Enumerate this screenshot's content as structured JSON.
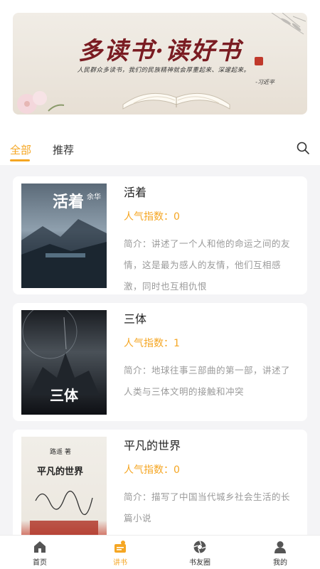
{
  "banner": {
    "title": "多读书·读好书",
    "quote": "人民群众多读书，我们的民族精神就会厚重起来、深邃起来。",
    "author": "-习近平"
  },
  "tabs": [
    {
      "label": "全部",
      "active": true
    },
    {
      "label": "推荐",
      "active": false
    }
  ],
  "books": [
    {
      "title": "活着",
      "popularity": "人气指数：0",
      "description": "简介：讲述了一个人和他的命运之间的友情，这是最为感人的友情，他们互相感激，同时也互相仇恨",
      "cover_title": "活着",
      "cover_author": "余华"
    },
    {
      "title": "三体",
      "popularity": "人气指数：1",
      "description": "简介：地球往事三部曲的第一部，讲述了人类与三体文明的接触和冲突",
      "cover_title": "三体"
    },
    {
      "title": "平凡的世界",
      "popularity": "人气指数：0",
      "description": "简介：描写了中国当代城乡社会生活的长篇小说",
      "cover_title": "平凡的世界",
      "cover_author": "路遥 著"
    }
  ],
  "nav": [
    {
      "label": "首页",
      "icon": "home-icon",
      "active": false
    },
    {
      "label": "讲书",
      "icon": "book-talk-icon",
      "active": true
    },
    {
      "label": "书友圈",
      "icon": "circle-icon",
      "active": false
    },
    {
      "label": "我的",
      "icon": "profile-icon",
      "active": false
    }
  ],
  "colors": {
    "accent": "#f5a623",
    "text": "#222222",
    "muted": "#9a9a9a"
  }
}
